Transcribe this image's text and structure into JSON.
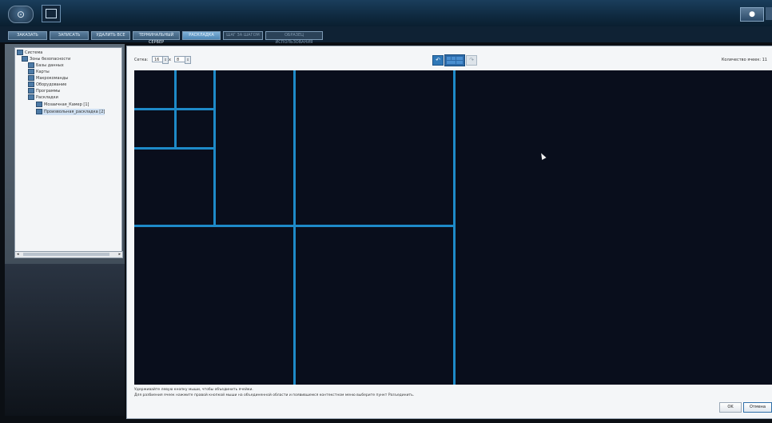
{
  "tabs": [
    "ЗАКАЗАТЬ",
    "ЗАПИСАТЬ",
    "УДАЛИТЬ ВСЕ",
    "ТЕРМИНАЛЬНЫЙ СЕРВЕР",
    "РАСКЛАДКА",
    "ШАГ ЗА ШАГОМ",
    "ОБРАЗЕЦ ИСПОЛЬЗОВАНИЯ"
  ],
  "tree": {
    "items": [
      {
        "label": "Система",
        "indent": 0
      },
      {
        "label": "Зоны безопасности",
        "indent": 1
      },
      {
        "label": "Базы данных",
        "indent": 2
      },
      {
        "label": "Карты",
        "indent": 2
      },
      {
        "label": "Макрокоманды",
        "indent": 2
      },
      {
        "label": "Оборудование",
        "indent": 2
      },
      {
        "label": "Программы",
        "indent": 2
      },
      {
        "label": "Раскладки",
        "indent": 2
      },
      {
        "label": "Мозаичная_Камер [1]",
        "indent": 3
      },
      {
        "label": "Произвольная_раскладка [2]",
        "indent": 3,
        "selected": true
      }
    ]
  },
  "dialog": {
    "grid_label": "Сетка:",
    "cols": "16",
    "rows": "8",
    "x_label": "x",
    "cells_count_label": "Количество ячеек: 11",
    "hint_line1": "Удерживайте левую кнопку мыши, чтобы объединить ячейки.",
    "hint_line2": "Для разбиения ячеек нажмите правой кнопкой мыши на объединенной области и появившемся контекстном меню выберите пункт Разъединить.",
    "ok": "OK",
    "cancel": "Отмена"
  }
}
